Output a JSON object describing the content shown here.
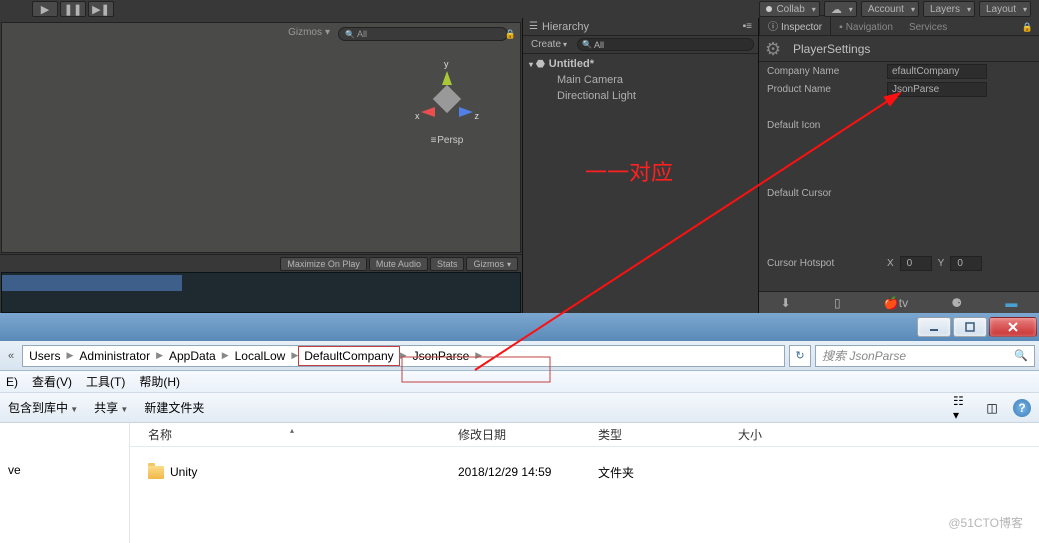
{
  "top": {
    "collab": "Collab",
    "account": "Account",
    "layers": "Layers",
    "layout": "Layout"
  },
  "scene": {
    "gizmos": "Gizmos",
    "search_ph": "All",
    "persp": "Persp",
    "axis": {
      "x": "x",
      "y": "y",
      "z": "z"
    },
    "bottom": {
      "maximize": "Maximize On Play",
      "mute": "Mute Audio",
      "stats": "Stats",
      "gizmos": "Gizmos"
    }
  },
  "hierarchy": {
    "tab": "Hierarchy",
    "create": "Create",
    "search_ph": "All",
    "root": "Untitled*",
    "items": [
      "Main Camera",
      "Directional Light"
    ]
  },
  "inspector": {
    "tabs": {
      "inspector": "Inspector",
      "navigation": "Navigation",
      "services": "Services"
    },
    "title": "PlayerSettings",
    "company_lbl": "Company Name",
    "company_val": "DefaultCompany",
    "company_val_vis": "efaultCompany",
    "product_lbl": "Product Name",
    "product_val": "JsonParse",
    "default_icon": "Default Icon",
    "default_cursor": "Default Cursor",
    "cursor_hotspot": "Cursor Hotspot",
    "hotspot": {
      "xl": "X",
      "xv": "0",
      "yl": "Y",
      "yv": "0"
    }
  },
  "annotation": "一一对应",
  "explorer": {
    "crumbs": [
      "Users",
      "Administrator",
      "AppData",
      "LocalLow",
      "DefaultCompany",
      "JsonParse"
    ],
    "search_ph": "搜索 JsonParse",
    "menu": [
      "E)",
      "查看(V)",
      "工具(T)",
      "帮助(H)"
    ],
    "toolbar": {
      "include": "包含到库中",
      "share": "共享",
      "newfolder": "新建文件夹"
    },
    "cols": {
      "name": "名称",
      "date": "修改日期",
      "type": "类型",
      "size": "大小"
    },
    "sidebar_item": "ve",
    "row": {
      "name": "Unity",
      "date": "2018/12/29 14:59",
      "type": "文件夹"
    }
  },
  "watermark": "@51CTO博客"
}
